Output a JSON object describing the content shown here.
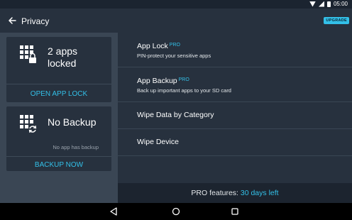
{
  "status_bar": {
    "time": "05:00",
    "icons": [
      "wifi-icon",
      "cell-signal-icon",
      "battery-icon"
    ]
  },
  "app_bar": {
    "title": "Privacy",
    "upgrade_label": "UPGRADE",
    "back_icon": "arrow-left-icon"
  },
  "cards": [
    {
      "value": "2 apps\nlocked",
      "value_line1": "2 apps",
      "value_line2": "locked",
      "subtext": "",
      "action_label": "OPEN APP LOCK",
      "icon": "grid-lock-icon"
    },
    {
      "value_line1": "No Backup",
      "subtext": "No app has backup",
      "action_label": "BACKUP NOW",
      "icon": "grid-sync-icon"
    }
  ],
  "menu": {
    "items": [
      {
        "title": "App Lock",
        "badge": "PRO",
        "subtitle": "PIN-protect your sensitive apps"
      },
      {
        "title": "App Backup",
        "badge": "PRO",
        "subtitle": "Back up important apps to your SD card"
      },
      {
        "title": "Wipe Data by Category"
      },
      {
        "title": "Wipe Device"
      }
    ]
  },
  "pro_banner": {
    "label": "PRO features:",
    "days": "30 days left"
  },
  "nav_bar": {
    "buttons": [
      "back-triangle-icon",
      "home-circle-icon",
      "recents-square-icon"
    ]
  },
  "colors": {
    "accent": "#33c0e8",
    "app_bar": "#27313e",
    "left_panel": "#3a4654",
    "banner": "#1c242f"
  }
}
